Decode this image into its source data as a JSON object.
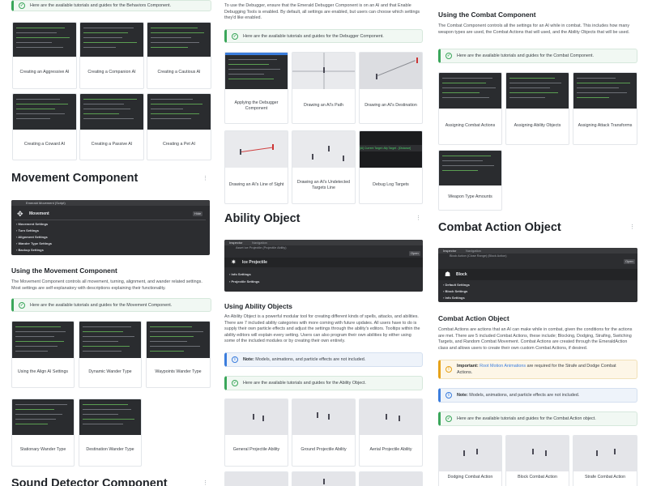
{
  "colors": {
    "tip": "#3aa65a",
    "note": "#3b7ddd",
    "important": "#e6a21a",
    "link": "#3b7ddd",
    "heading": "#1f2328"
  },
  "col1": {
    "behaviors_tip": "Here are the available tutorials and guides for the Behaviors Component.",
    "behavior_cards": [
      "Creating an Aggressive AI",
      "Creating a Companion AI",
      "Creating a Cautious AI",
      "Creating a Coward AI",
      "Creating a Passive AI",
      "Creating a Pet AI"
    ],
    "movement_title": "Movement Component",
    "movement_panel": {
      "title_bar": "Emerald Movement (Script)",
      "heading": "Movement",
      "button": "Hide",
      "rows": [
        "Movement Settings",
        "Turn Settings",
        "Alignment Settings",
        "Wander Type Settings",
        "Backup Settings"
      ]
    },
    "using_movement_heading": "Using the Movement Component",
    "using_movement_text": "The Movement Component controls all movement, turning, alignment, and wander related settings. Most settings are self-explanatory with descriptions explaining their functionality.",
    "movement_tip": "Here are the available tutorials and guides for the Movement Component.",
    "movement_cards": [
      "Using the Align AI Settings",
      "Dynamic Wander Type",
      "Waypoints Wander Type",
      "Stationary Wander Type",
      "Destination Wander Type"
    ],
    "sound_title": "Sound Detector Component"
  },
  "col2": {
    "debugger_text": "To use the Debugger, ensure that the Emerald Debugger Component is on an AI and that Enable Debugging Tools is enabled. By default, all settings are enabled, but users can choose which settings they'd like enabled.",
    "debugger_tip": "Here are the available tutorials and guides for the Debugger Component.",
    "debugger_cards": [
      "Applying the Debugger Component",
      "Drawing an AI's Path",
      "Drawing an AI's Destination",
      "Drawing an AI's Line of Sight",
      "Drawing an AI's Undetected Targets Line",
      "Debug Log Targets"
    ],
    "debug_log_line": "[AI] Current Target: Ally Target - [Distance] ",
    "ability_title": "Ability Object",
    "ability_panel": {
      "tab1": "Inspector",
      "tab2": "Navigation",
      "path": "Asset Ice Projectile (Projectile Ability)",
      "open": "Open",
      "heading": "Ice Projectile",
      "rows": [
        "Info Settings",
        "Projectile Settings"
      ]
    },
    "using_ability_heading": "Using Ability Objects",
    "using_ability_text": "An Ability Object is a powerful modular tool for creating different kinds of spells, attacks, and abilities. There are 7 included ability categories with more coming with future updates. All users have to do is supply their own particle effects and adjust the settings through the ability's editors. Tooltips within the ability editors will explain every setting. Users can also program their own abilities by either using some of the included modules or by creating their own entirely.",
    "ability_note_label": "Note:",
    "ability_note_text": "Models, animations, and particle effects are not included.",
    "ability_tip": "Here are the available tutorials and guides for the Ability Object.",
    "ability_cards": [
      "General Projectile Ability",
      "Ground Projectile Ability",
      "Aerial Projectile Ability"
    ]
  },
  "col3": {
    "using_combat_heading": "Using the Combat Component",
    "using_combat_text": "The Combat Component controls all the settings for an AI while in combat. This includes how many weapon types are used, the Combat Actions that will used, and the Ability Objects that will be used.",
    "combat_tip": "Here are the available tutorials and guides for the Combat Component.",
    "combat_cards": [
      "Assigning Combat Actions",
      "Assigning Ability Objects",
      "Assigning Attack Transforms",
      "Weapon Type Amounts"
    ],
    "combat_action_title": "Combat Action Object",
    "action_panel": {
      "tab1": "Inspector",
      "tab2": "Navigation",
      "path": "Block Action (Close Range) (Block Action)",
      "open": "Open",
      "heading": "Block",
      "rows": [
        "Default Settings",
        "Block Settings",
        "Info Settings"
      ]
    },
    "combat_action_heading": "Combat Action Object",
    "combat_action_text": "Combat Actions are actions that an AI can make while in combat, given the conditions for the actions are met. There are 5 included Combat Actions, these include; Blocking, Dodging, Strafing, Switching Targets, and Random Combat Movement. Combat Actions are created through the EmeraldAction class and allows users to create their own custom Combat Actions, if desired.",
    "important_label": "Important:",
    "important_link": "Root Motion Animations",
    "important_text": "are required for the Strafe and Dodge Combat Actions.",
    "action_note_label": "Note:",
    "action_note_text": "Models, animations, and particle effects are not included.",
    "action_tip": "Here are the available tutorials and guides for the Combat Action object.",
    "action_cards": [
      "Dodging Combat Action",
      "Block Combat Action",
      "Strafe Combat Action"
    ]
  }
}
